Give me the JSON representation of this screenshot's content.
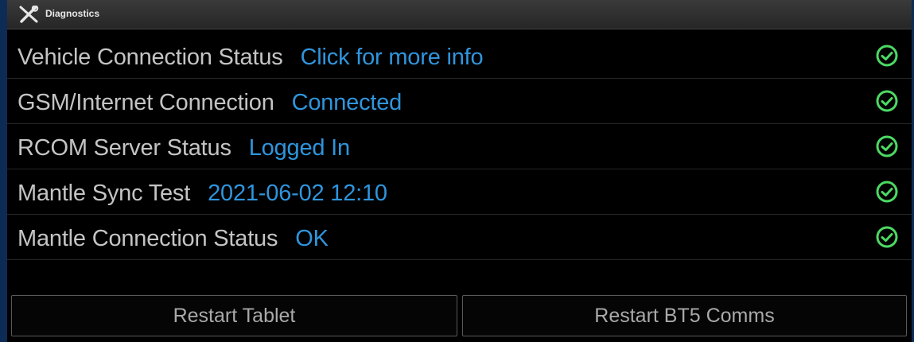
{
  "window": {
    "title": "Diagnostics",
    "icon": "wrench-screwdriver-icon"
  },
  "rows": [
    {
      "label": "Vehicle Connection Status",
      "value": "Click for more info",
      "status_icon": "check-circle-icon"
    },
    {
      "label": "GSM/Internet Connection",
      "value": "Connected",
      "status_icon": "check-circle-icon"
    },
    {
      "label": "RCOM Server Status",
      "value": "Logged In",
      "status_icon": "check-circle-icon"
    },
    {
      "label": "Mantle Sync Test",
      "value": "2021-06-02 12:10",
      "status_icon": "check-circle-icon"
    },
    {
      "label": "Mantle Connection Status",
      "value": "OK",
      "status_icon": "check-circle-icon"
    }
  ],
  "buttons": {
    "restart_tablet": "Restart Tablet",
    "restart_bt5": "Restart BT5 Comms"
  },
  "colors": {
    "value_text": "#2f95dd",
    "label_text": "#c4c4c4",
    "status_ok": "#4cd964",
    "background": "#000000",
    "outer_frame": "#0d2c55"
  }
}
